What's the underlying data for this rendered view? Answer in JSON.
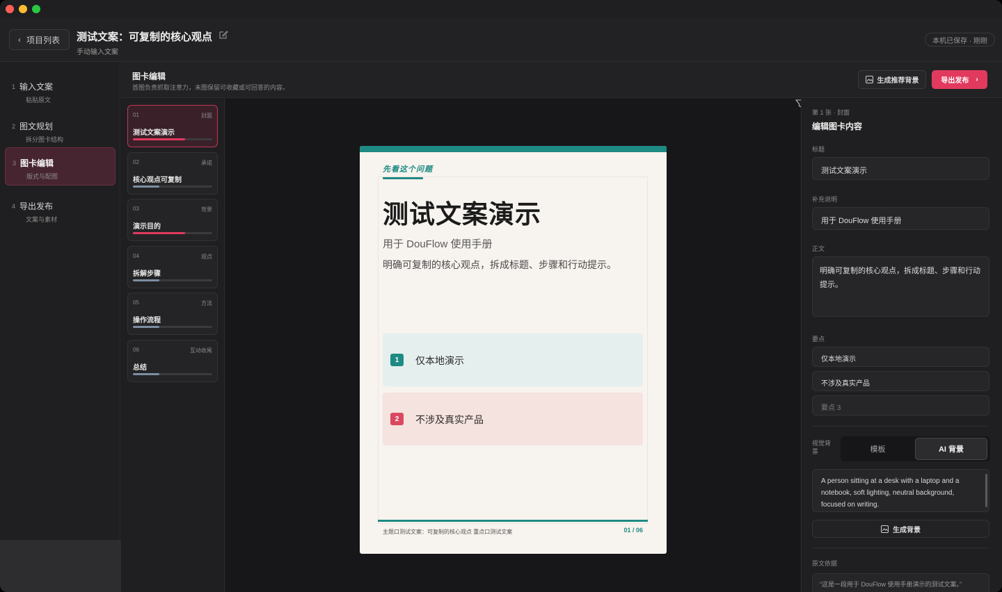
{
  "header": {
    "back_label": "项目列表",
    "title": "测试文案：可复制的核心观点",
    "subtitle": "手动输入文案",
    "save_status": "本机已保存 · 刚刚"
  },
  "steps": [
    {
      "num": "1",
      "label": "输入文案",
      "sub": "粘贴原文"
    },
    {
      "num": "2",
      "label": "图文规划",
      "sub": "拆分图卡结构"
    },
    {
      "num": "3",
      "label": "图卡编辑",
      "sub": "版式与配图"
    },
    {
      "num": "4",
      "label": "导出发布",
      "sub": "文案与素材"
    }
  ],
  "subheader": {
    "title": "图卡编辑",
    "desc": "首图负责抓取注意力，末图保留可收藏或可回答的内容。",
    "generate_label": "生成推荐背景",
    "publish_label": "导出发布"
  },
  "cards": [
    {
      "num": "01",
      "tag": "封面",
      "title": "测试文案演示",
      "progress": 0.66,
      "color": "#e23a5f"
    },
    {
      "num": "02",
      "tag": "承诺",
      "title": "核心观点可复制",
      "progress": 0.33,
      "color": "#7d8ea3"
    },
    {
      "num": "03",
      "tag": "背景",
      "title": "演示目的",
      "progress": 0.66,
      "color": "#e23a5f"
    },
    {
      "num": "04",
      "tag": "观点",
      "title": "拆解步骤",
      "progress": 0.33,
      "color": "#7d8ea3"
    },
    {
      "num": "05",
      "tag": "方法",
      "title": "操作流程",
      "progress": 0.33,
      "color": "#7d8ea3"
    },
    {
      "num": "06",
      "tag": "互动收尾",
      "title": "总结",
      "progress": 0.33,
      "color": "#7d8ea3"
    }
  ],
  "poster": {
    "kicker": "先看这个问题",
    "title": "测试文案演示",
    "subtitle": "用于 DouFlow 使用手册",
    "body": "明确可复制的核心观点，拆成标题、步骤和行动提示。",
    "points": [
      {
        "badge": "1",
        "text": "仅本地演示"
      },
      {
        "badge": "2",
        "text": "不涉及真实产品"
      }
    ],
    "footer": "主题口测试文案：可复制的核心观点  重点口测试文案",
    "page": "01 / 06",
    "accent": "#1e8a84"
  },
  "editor": {
    "crumb": "第 1 张 · 封面",
    "heading": "编辑图卡内容",
    "title_label": "标题",
    "title_value": "测试文案演示",
    "note_label": "补充说明",
    "note_value": "用于 DouFlow 使用手册",
    "body_label": "正文",
    "body_value": "明确可复制的核心观点，拆成标题、步骤和行动提示。",
    "points_label": "要点",
    "point1": "仅本地演示",
    "point2": "不涉及真实产品",
    "point3_placeholder": "要点 3",
    "visual_label": "视觉背景",
    "seg_template": "模板",
    "seg_ai": "AI 背景",
    "prompt": "A person sitting at a desk with a laptop and a notebook, soft lighting, neutral background, focused on writing.",
    "gen_bg_label": "生成背景",
    "source_label": "原文依据",
    "source_value": "“这是一段用于 DouFlow 使用手册演示的测试文案。”"
  }
}
